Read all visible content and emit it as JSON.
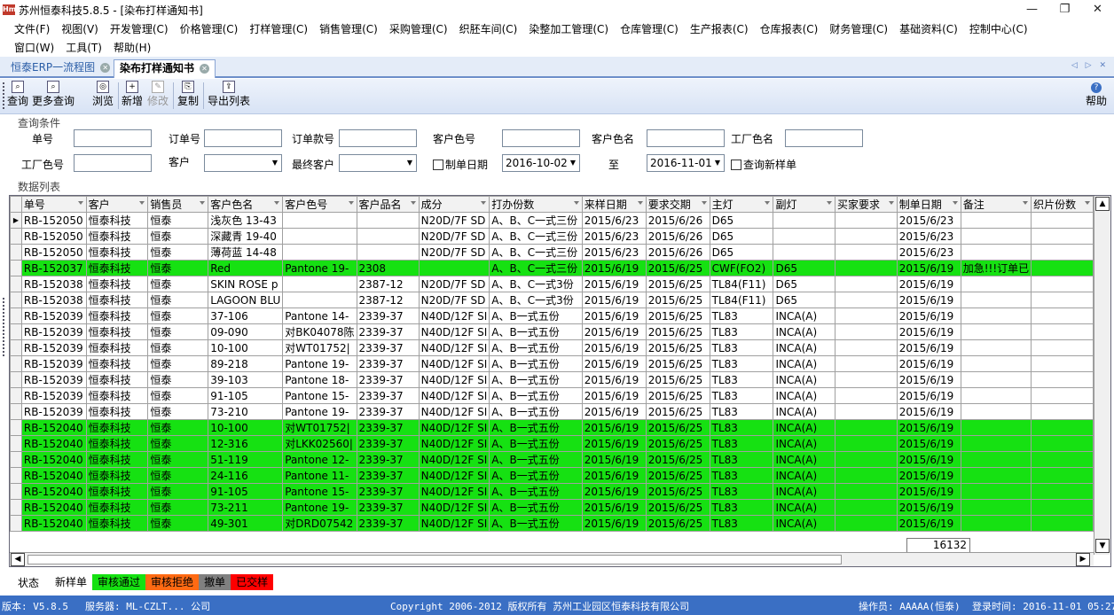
{
  "window": {
    "title": "苏州恒泰科技5.8.5 - [染布打样通知书]",
    "logo": "Hm",
    "minimize": "—",
    "restore": "❐",
    "close": "✕"
  },
  "menu": {
    "row1": [
      "文件(F)",
      "视图(V)",
      "开发管理(C)",
      "价格管理(C)",
      "打样管理(C)",
      "销售管理(C)",
      "采购管理(C)",
      "织胚车间(C)",
      "染整加工管理(C)",
      "仓库管理(C)",
      "生产报表(C)",
      "仓库报表(C)",
      "财务管理(C)",
      "基础资料(C)",
      "控制中心(C)"
    ],
    "row2": [
      "窗口(W)",
      "工具(T)",
      "帮助(H)"
    ]
  },
  "tabs": [
    {
      "label": "恒泰ERP一流程图"
    },
    {
      "label": "染布打样通知书"
    }
  ],
  "tab_nav": "◁ ▷ ✕",
  "toolbar": {
    "query": "查询",
    "more_query": "更多查询",
    "browse": "浏览",
    "new": "新增",
    "modify": "修改",
    "copy": "复制",
    "export": "导出列表",
    "help": "帮助",
    "help_icon": "?"
  },
  "query_section": {
    "title": "查询条件",
    "order_no": "单号",
    "sub_order_no": "订单号",
    "order_style_no": "订单款号",
    "cust_color_no": "客户色号",
    "cust_color_name": "客户色名",
    "factory_color_name": "工厂色名",
    "factory_color_no": "工厂色号",
    "customer": "客户",
    "final_customer": "最终客户",
    "made_date_chk": "制单日期",
    "date_from": "2016-10-02",
    "to": "至",
    "date_to": "2016-11-01",
    "query_new_sample": "查询新样单"
  },
  "data_section": {
    "title": "数据列表"
  },
  "grid": {
    "columns": [
      "单号",
      "客户",
      "销售员",
      "客户色名",
      "客户色号",
      "客户品名",
      "成分",
      "打办份数",
      "来样日期",
      "要求交期",
      "主灯",
      "副灯",
      "买家要求",
      "制单日期",
      "备注",
      "织片份数"
    ],
    "rows": [
      {
        "hl": false,
        "cur": true,
        "c": [
          "RB-152050",
          "恒泰科技",
          "恒泰",
          "浅灰色 13-43",
          "",
          "",
          "N20D/7F SD",
          "A、B、C一式三份",
          "2015/6/23",
          "2015/6/26",
          "D65",
          "",
          "",
          "2015/6/23",
          "",
          ""
        ]
      },
      {
        "hl": false,
        "cur": false,
        "c": [
          "RB-152050",
          "恒泰科技",
          "恒泰",
          "深藏青 19-40",
          "",
          "",
          "N20D/7F SD",
          "A、B、C一式三份",
          "2015/6/23",
          "2015/6/26",
          "D65",
          "",
          "",
          "2015/6/23",
          "",
          ""
        ]
      },
      {
        "hl": false,
        "cur": false,
        "c": [
          "RB-152050",
          "恒泰科技",
          "恒泰",
          "薄荷蓝 14-48",
          "",
          "",
          "N20D/7F SD",
          "A、B、C一式三份",
          "2015/6/23",
          "2015/6/26",
          "D65",
          "",
          "",
          "2015/6/23",
          "",
          ""
        ]
      },
      {
        "hl": true,
        "cur": false,
        "c": [
          "RB-152037",
          "恒泰科技",
          "恒泰",
          "Red",
          "Pantone 19-",
          "2308",
          "",
          "A、B、C一式三份",
          "2015/6/19",
          "2015/6/25",
          "CWF(FO2)",
          "D65",
          "",
          "2015/6/19",
          "加急!!!订单已",
          ""
        ]
      },
      {
        "hl": false,
        "cur": false,
        "c": [
          "RB-152038",
          "恒泰科技",
          "恒泰",
          "SKIN ROSE p",
          "",
          "2387-12",
          "N20D/7F SD",
          "A、B、C一式3份",
          "2015/6/19",
          "2015/6/25",
          "TL84(F11)",
          "D65",
          "",
          "2015/6/19",
          "",
          ""
        ]
      },
      {
        "hl": false,
        "cur": false,
        "c": [
          "RB-152038",
          "恒泰科技",
          "恒泰",
          "LAGOON BLU",
          "",
          "2387-12",
          "N20D/7F SD",
          "A、B、C一式3份",
          "2015/6/19",
          "2015/6/25",
          "TL84(F11)",
          "D65",
          "",
          "2015/6/19",
          "",
          ""
        ]
      },
      {
        "hl": false,
        "cur": false,
        "c": [
          "RB-152039",
          "恒泰科技",
          "恒泰",
          "37-106",
          "Pantone 14-",
          "2339-37",
          "N40D/12F SI",
          "A、B一式五份",
          "2015/6/19",
          "2015/6/25",
          "TL83",
          "INCA(A)",
          "",
          "2015/6/19",
          "",
          ""
        ]
      },
      {
        "hl": false,
        "cur": false,
        "c": [
          "RB-152039",
          "恒泰科技",
          "恒泰",
          "09-090",
          "对BK04078陈",
          "2339-37",
          "N40D/12F SI",
          "A、B一式五份",
          "2015/6/19",
          "2015/6/25",
          "TL83",
          "INCA(A)",
          "",
          "2015/6/19",
          "",
          ""
        ]
      },
      {
        "hl": false,
        "cur": false,
        "c": [
          "RB-152039",
          "恒泰科技",
          "恒泰",
          "10-100",
          "对WT01752|",
          "2339-37",
          "N40D/12F SI",
          "A、B一式五份",
          "2015/6/19",
          "2015/6/25",
          "TL83",
          "INCA(A)",
          "",
          "2015/6/19",
          "",
          ""
        ]
      },
      {
        "hl": false,
        "cur": false,
        "c": [
          "RB-152039",
          "恒泰科技",
          "恒泰",
          "89-218",
          "Pantone 19-",
          "2339-37",
          "N40D/12F SI",
          "A、B一式五份",
          "2015/6/19",
          "2015/6/25",
          "TL83",
          "INCA(A)",
          "",
          "2015/6/19",
          "",
          ""
        ]
      },
      {
        "hl": false,
        "cur": false,
        "c": [
          "RB-152039",
          "恒泰科技",
          "恒泰",
          "39-103",
          "Pantone 18-",
          "2339-37",
          "N40D/12F SI",
          "A、B一式五份",
          "2015/6/19",
          "2015/6/25",
          "TL83",
          "INCA(A)",
          "",
          "2015/6/19",
          "",
          ""
        ]
      },
      {
        "hl": false,
        "cur": false,
        "c": [
          "RB-152039",
          "恒泰科技",
          "恒泰",
          "91-105",
          "Pantone 15-",
          "2339-37",
          "N40D/12F SI",
          "A、B一式五份",
          "2015/6/19",
          "2015/6/25",
          "TL83",
          "INCA(A)",
          "",
          "2015/6/19",
          "",
          ""
        ]
      },
      {
        "hl": false,
        "cur": false,
        "c": [
          "RB-152039",
          "恒泰科技",
          "恒泰",
          "73-210",
          "Pantone 19-",
          "2339-37",
          "N40D/12F SI",
          "A、B一式五份",
          "2015/6/19",
          "2015/6/25",
          "TL83",
          "INCA(A)",
          "",
          "2015/6/19",
          "",
          ""
        ]
      },
      {
        "hl": true,
        "cur": false,
        "c": [
          "RB-152040",
          "恒泰科技",
          "恒泰",
          "10-100",
          "对WT01752|",
          "2339-37",
          "N40D/12F SI",
          "A、B一式五份",
          "2015/6/19",
          "2015/6/25",
          "TL83",
          "INCA(A)",
          "",
          "2015/6/19",
          "",
          ""
        ]
      },
      {
        "hl": true,
        "cur": false,
        "c": [
          "RB-152040",
          "恒泰科技",
          "恒泰",
          "12-316",
          "对LKK02560|",
          "2339-37",
          "N40D/12F SI",
          "A、B一式五份",
          "2015/6/19",
          "2015/6/25",
          "TL83",
          "INCA(A)",
          "",
          "2015/6/19",
          "",
          ""
        ]
      },
      {
        "hl": true,
        "cur": false,
        "c": [
          "RB-152040",
          "恒泰科技",
          "恒泰",
          "51-119",
          "Pantone 12-",
          "2339-37",
          "N40D/12F SI",
          "A、B一式五份",
          "2015/6/19",
          "2015/6/25",
          "TL83",
          "INCA(A)",
          "",
          "2015/6/19",
          "",
          ""
        ]
      },
      {
        "hl": true,
        "cur": false,
        "c": [
          "RB-152040",
          "恒泰科技",
          "恒泰",
          "24-116",
          "Pantone 11-",
          "2339-37",
          "N40D/12F SI",
          "A、B一式五份",
          "2015/6/19",
          "2015/6/25",
          "TL83",
          "INCA(A)",
          "",
          "2015/6/19",
          "",
          ""
        ]
      },
      {
        "hl": true,
        "cur": false,
        "c": [
          "RB-152040",
          "恒泰科技",
          "恒泰",
          "91-105",
          "Pantone 15-",
          "2339-37",
          "N40D/12F SI",
          "A、B一式五份",
          "2015/6/19",
          "2015/6/25",
          "TL83",
          "INCA(A)",
          "",
          "2015/6/19",
          "",
          ""
        ]
      },
      {
        "hl": true,
        "cur": false,
        "c": [
          "RB-152040",
          "恒泰科技",
          "恒泰",
          "73-211",
          "Pantone 19-",
          "2339-37",
          "N40D/12F SI",
          "A、B一式五份",
          "2015/6/19",
          "2015/6/25",
          "TL83",
          "INCA(A)",
          "",
          "2015/6/19",
          "",
          ""
        ]
      },
      {
        "hl": true,
        "cur": false,
        "c": [
          "RB-152040",
          "恒泰科技",
          "恒泰",
          "49-301",
          "对DRD07542",
          "2339-37",
          "N40D/12F SI",
          "A、B一式五份",
          "2015/6/19",
          "2015/6/25",
          "TL83",
          "INCA(A)",
          "",
          "2015/6/19",
          "",
          ""
        ]
      }
    ],
    "footer_total": "16132"
  },
  "status": {
    "label": "状态",
    "legend": [
      {
        "text": "新样单",
        "bg": "#ffffff",
        "fg": "#000000"
      },
      {
        "text": "审核通过",
        "bg": "#16e112",
        "fg": "#000000"
      },
      {
        "text": "审核拒绝",
        "bg": "#ff6a13",
        "fg": "#000000"
      },
      {
        "text": "撤单",
        "bg": "#808080",
        "fg": "#000000"
      },
      {
        "text": "已交样",
        "bg": "#ff0000",
        "fg": "#000000"
      }
    ]
  },
  "bottombar": {
    "version": "版本: V5.8.5",
    "server": "服务器: ML-CZLT... 公司",
    "copyright": "Copyright 2006-2012 版权所有  苏州工业园区恒泰科技有限公司",
    "operator": "操作员: AAAAA(恒泰)",
    "login_time": "登录时间: 2016-11-01 05:27"
  },
  "colors": {
    "approved_row": "#16e112",
    "tab_accent": "#3a6fc4",
    "bottombar": "#3a6fc4"
  }
}
